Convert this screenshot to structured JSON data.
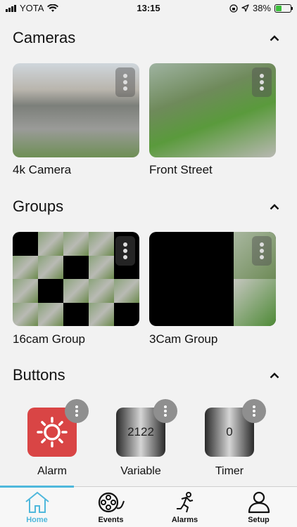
{
  "status": {
    "carrier": "YOTA",
    "time": "13:15",
    "battery": "38%",
    "battery_level": 0.38
  },
  "sections": {
    "cameras": {
      "title": "Cameras"
    },
    "groups": {
      "title": "Groups"
    },
    "buttons": {
      "title": "Buttons"
    }
  },
  "cameras": [
    {
      "label": "4k Camera"
    },
    {
      "label": "Front Street"
    }
  ],
  "groups": [
    {
      "label": "16cam Group"
    },
    {
      "label": "3Cam Group"
    }
  ],
  "buttons": [
    {
      "label": "Alarm",
      "icon": "sun-icon",
      "color": "#d94545"
    },
    {
      "label": "Variable",
      "value": "2122"
    },
    {
      "label": "Timer",
      "value": "0"
    }
  ],
  "tabs": [
    {
      "label": "Home",
      "icon": "home-icon",
      "active": true
    },
    {
      "label": "Events",
      "icon": "film-reel-icon"
    },
    {
      "label": "Alarms",
      "icon": "running-person-icon"
    },
    {
      "label": "Setup",
      "icon": "user-icon"
    }
  ],
  "colors": {
    "accent": "#4fb8dc",
    "alarm": "#d94545"
  }
}
